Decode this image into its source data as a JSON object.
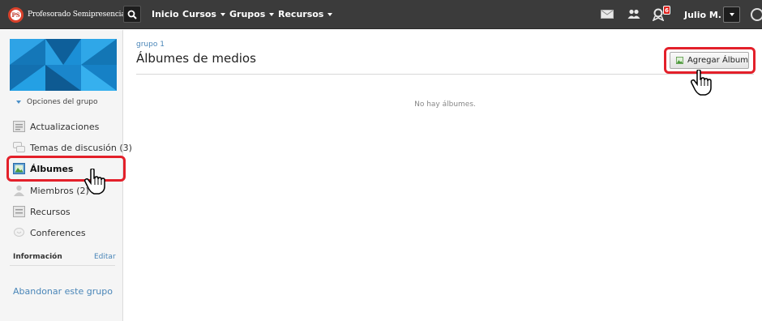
{
  "brand": {
    "logo_initials": "PS",
    "name": "Profesorado Semipresencial"
  },
  "topnav": {
    "items": [
      {
        "label": "Inicio",
        "dropdown": false
      },
      {
        "label": "Cursos",
        "dropdown": true
      },
      {
        "label": "Grupos",
        "dropdown": true
      },
      {
        "label": "Recursos",
        "dropdown": true
      }
    ],
    "notification_count": "6",
    "user_name": "Julio M."
  },
  "sidebar": {
    "group_options": "Opciones del grupo",
    "items": [
      {
        "label": "Actualizaciones",
        "icon": "updates-icon",
        "active": false
      },
      {
        "label": "Temas de discusión (3)",
        "icon": "discussion-icon",
        "active": false
      },
      {
        "label": "Álbumes",
        "icon": "album-icon",
        "active": true
      },
      {
        "label": "Miembros (2)",
        "icon": "members-icon",
        "active": false
      },
      {
        "label": "Recursos",
        "icon": "resources-icon",
        "active": false
      },
      {
        "label": "Conferences",
        "icon": "conferences-icon",
        "active": false
      }
    ],
    "info_label": "Información",
    "info_edit": "Editar",
    "leave_group": "Abandonar este grupo"
  },
  "main": {
    "breadcrumb": "grupo 1",
    "title": "Álbumes de medios",
    "add_button": "Agregar Álbum",
    "empty_message": "No hay álbumes."
  },
  "colors": {
    "highlight": "#e3202a",
    "link": "#4a86b8",
    "topbar": "#3b3b3b"
  }
}
